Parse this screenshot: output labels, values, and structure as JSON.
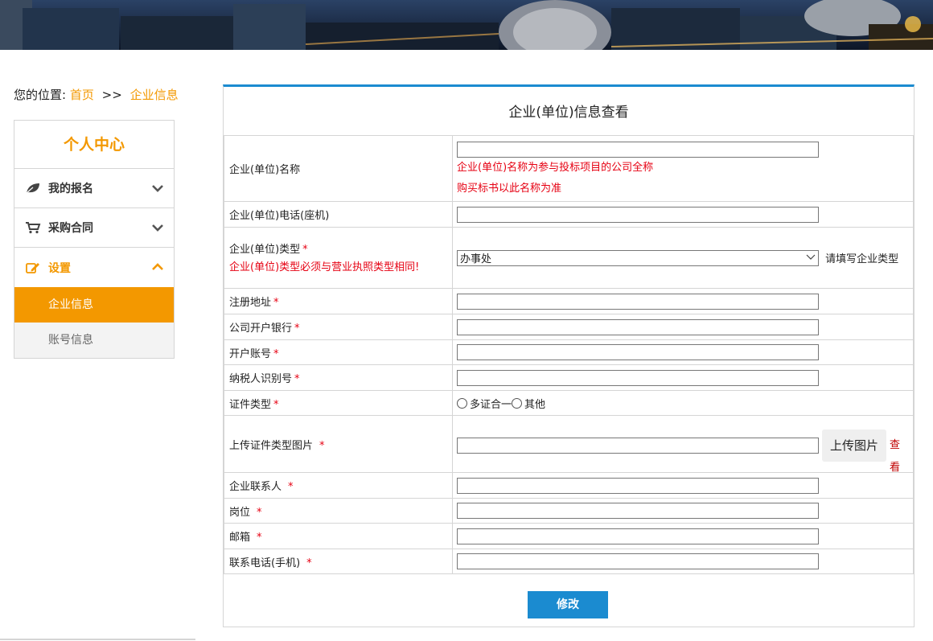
{
  "breadcrumb": {
    "prefix": "您的位置:",
    "home": "首页",
    "separator": ">>",
    "current": "企业信息"
  },
  "sidebar": {
    "title": "个人中心",
    "items": [
      {
        "label": "我的报名",
        "icon": "leaf-icon"
      },
      {
        "label": "采购合同",
        "icon": "cart-icon"
      },
      {
        "label": "设置",
        "icon": "edit-icon"
      }
    ],
    "subitems": [
      {
        "label": "企业信息"
      },
      {
        "label": "账号信息"
      }
    ]
  },
  "form": {
    "title": "企业(单位)信息查看",
    "fields": {
      "name": {
        "label": "企业(单位)名称",
        "value": "",
        "note1": "企业(单位)名称为参与投标项目的公司全称",
        "note2": "购买标书以此名称为准"
      },
      "phone": {
        "label": "企业(单位)电话(座机)",
        "value": ""
      },
      "type": {
        "label": "企业(单位)类型",
        "note": "企业(单位)类型必须与营业执照类型相同!",
        "selected": "办事处",
        "hint": "请填写企业类型"
      },
      "address": {
        "label": "注册地址",
        "value": ""
      },
      "bank": {
        "label": "公司开户银行",
        "value": ""
      },
      "account": {
        "label": "开户账号",
        "value": ""
      },
      "taxid": {
        "label": "纳税人识别号",
        "value": ""
      },
      "certtype": {
        "label": "证件类型",
        "option1": "多证合一",
        "option2": "其他"
      },
      "upload": {
        "label": "上传证件类型图片",
        "value": "",
        "button": "上传图片",
        "view": "查看"
      },
      "contact": {
        "label": "企业联系人",
        "value": ""
      },
      "position": {
        "label": "岗位",
        "value": ""
      },
      "email": {
        "label": "邮箱",
        "value": ""
      },
      "mobile": {
        "label": "联系电话(手机)",
        "value": ""
      }
    },
    "required_mark": "*",
    "submit": "修改"
  },
  "colors": {
    "accent": "#f39800",
    "primary": "#1b8bd0",
    "warn": "#e60012"
  }
}
